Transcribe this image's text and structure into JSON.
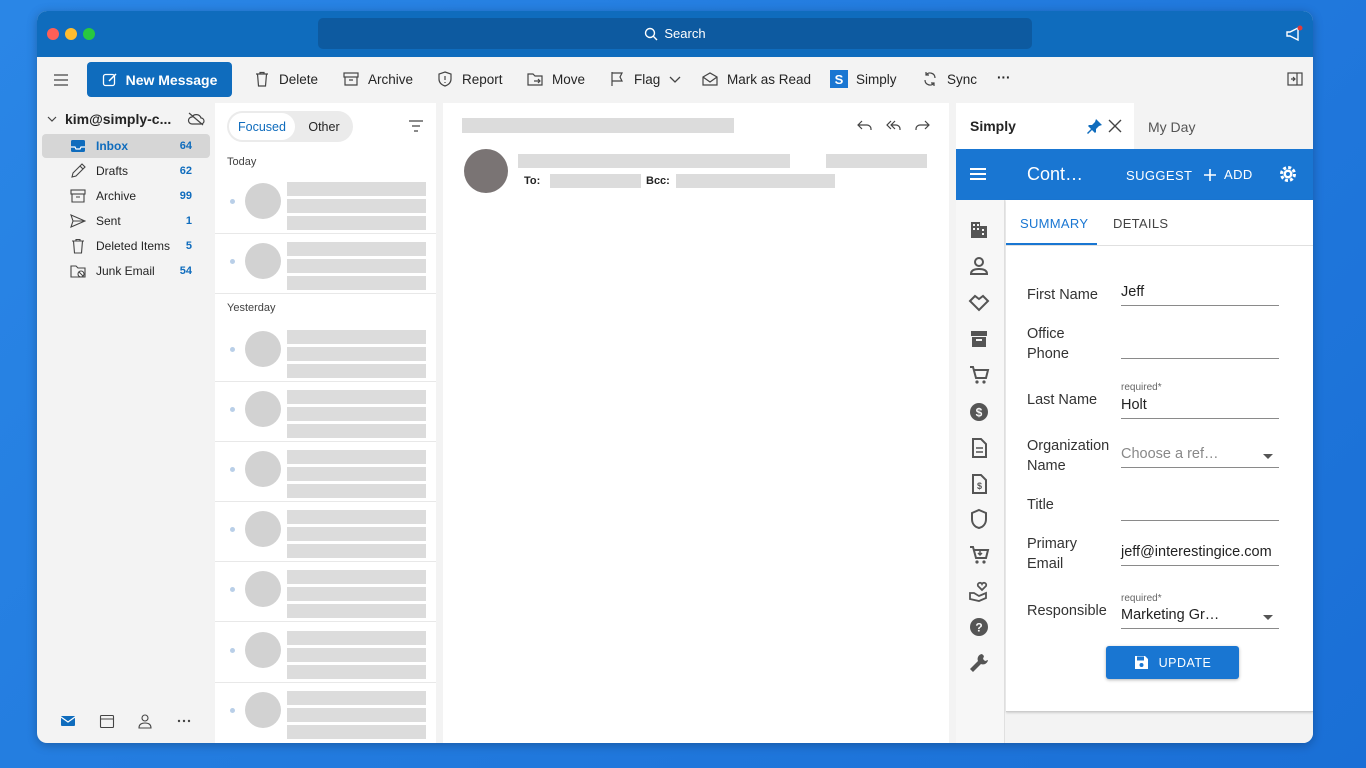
{
  "window": {
    "search_label": "Search"
  },
  "toolbar": {
    "new_message": "New Message",
    "delete": "Delete",
    "archive": "Archive",
    "report": "Report",
    "move": "Move",
    "flag": "Flag",
    "mark_as_read": "Mark as Read",
    "simply": "Simply",
    "sync": "Sync",
    "more": "···"
  },
  "account": {
    "name": "kim@simply-c..."
  },
  "folders": [
    {
      "label": "Inbox",
      "count": "64",
      "icon": "inbox-icon"
    },
    {
      "label": "Drafts",
      "count": "62",
      "icon": "pencil-icon"
    },
    {
      "label": "Archive",
      "count": "99",
      "icon": "archive-icon"
    },
    {
      "label": "Sent",
      "count": "1",
      "icon": "send-icon"
    },
    {
      "label": "Deleted Items",
      "count": "5",
      "icon": "trash-icon"
    },
    {
      "label": "Junk Email",
      "count": "54",
      "icon": "junk-icon"
    }
  ],
  "message_list": {
    "tab_focused": "Focused",
    "tab_other": "Other",
    "group_today": "Today",
    "group_yesterday": "Yesterday"
  },
  "reading_pane": {
    "to_label": "To:",
    "bcc_label": "Bcc:"
  },
  "addin": {
    "title": "Simply",
    "my_day": "My Day",
    "bar_title": "Cont…",
    "suggest": "SUGGEST",
    "add": "ADD",
    "tab_summary": "SUMMARY",
    "tab_details": "DETAILS",
    "fields": {
      "first_name_label": "First Name",
      "first_name_value": "Jeff",
      "office_phone_label_1": "Office",
      "office_phone_label_2": "Phone",
      "office_phone_value": "",
      "last_name_label": "Last Name",
      "last_name_required": "required*",
      "last_name_value": "Holt",
      "org_label_1": "Organization",
      "org_label_2": "Name",
      "org_placeholder": "Choose a ref…",
      "title_label": "Title",
      "title_value": "",
      "email_label_1": "Primary",
      "email_label_2": "Email",
      "email_value": "jeff@interestingice.com",
      "responsible_label": "Responsible",
      "responsible_required": "required*",
      "responsible_value": "Marketing Gr…"
    },
    "update_button": "UPDATE"
  },
  "colors": {
    "accent": "#0f6cbd",
    "addin_bar": "#1976d2"
  }
}
